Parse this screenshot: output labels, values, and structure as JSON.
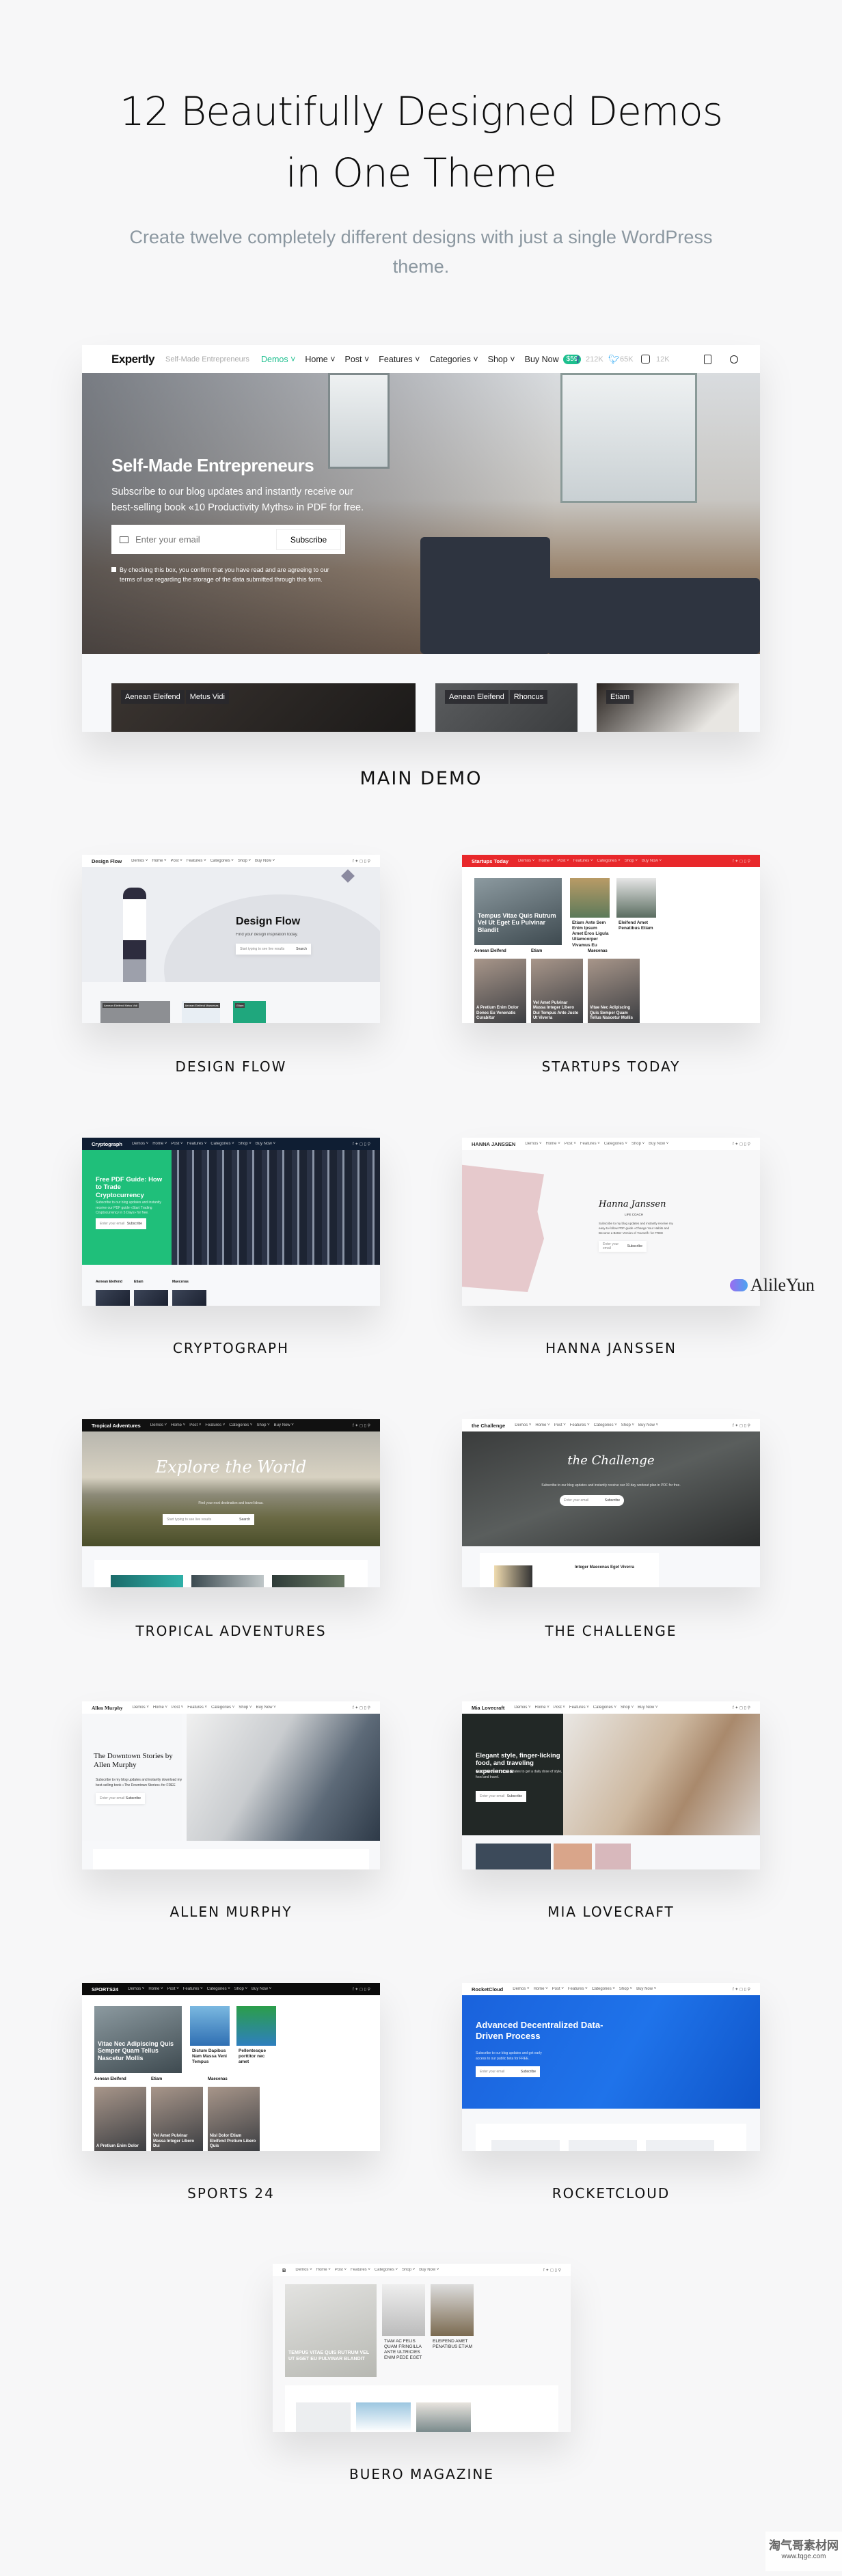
{
  "header": {
    "title_line1": "12 Beautifully Designed Demos",
    "title_line2": "in One Theme",
    "subtitle": "Create twelve completely different designs with just a single WordPress theme."
  },
  "main_demo": {
    "label": "MAIN DEMO",
    "brand": "Expertly",
    "tagline": "Self-Made Entrepreneurs",
    "nav": [
      {
        "label": "Demos",
        "active": true
      },
      {
        "label": "Home"
      },
      {
        "label": "Post"
      },
      {
        "label": "Features"
      },
      {
        "label": "Categories"
      },
      {
        "label": "Shop"
      },
      {
        "label": "Buy Now"
      }
    ],
    "price_badge": "$59",
    "social": [
      {
        "icon": "facebook-icon",
        "count": "212K"
      },
      {
        "icon": "twitter-icon",
        "count": "65K"
      },
      {
        "icon": "instagram-icon",
        "count": "12K"
      }
    ],
    "hero_title": "Self-Made Entrepreneurs",
    "hero_text": "Subscribe to our blog updates and instantly receive our best-selling book «10 Productivity Myths» in PDF for free.",
    "email_placeholder": "Enter your email",
    "subscribe": "Subscribe",
    "consent": "By checking this box, you confirm that you have read and are agreeing to our terms of use regarding the storage of the data submitted through this form.",
    "cards": [
      {
        "tags": [
          "Aenean Eleifend",
          "Metus Vidi"
        ]
      },
      {
        "tags": [
          "Aenean Eleifend",
          "Rhoncus"
        ]
      },
      {
        "tags": [
          "Etiam"
        ]
      }
    ],
    "colors": {
      "accent": "#1dbf8e"
    }
  },
  "demos": [
    {
      "label": "DESIGN FLOW",
      "layout": "illustration",
      "brand": "Design Flow",
      "nav_bg": "#ffffff",
      "nav_fg": "#222222",
      "hero_bg": "#eceef2",
      "fg": "#111111",
      "headline": "Design Flow",
      "sub": "Find your design inspiration today.",
      "input": "Start typing to see live results",
      "button": "Search",
      "cards": [
        {
          "tags": "Aenean Eleifend  Metus Vidi"
        },
        {
          "tags": "Aenean Eleifend  Maecenas"
        },
        {
          "tags": "Etiam"
        }
      ]
    },
    {
      "label": "STARTUPS TODAY",
      "layout": "magazine",
      "brand": "Startups Today",
      "nav_bg": "#e8282b",
      "nav_fg": "#ffffff",
      "headline": "Tempus Vitae Quis Rutrum Vel Ut Eget Eu Pulvinar Blandit",
      "side": [
        "Etiam Ante Sem Enim Ipsum Amet Eros Ligula Ullamcorper Vivamus Eu",
        "Eleifend Amet Penatibus Etiam"
      ],
      "sections": [
        "Aenean Eleifend",
        "Etiam",
        "Maecenas"
      ],
      "bottom": [
        "A Pretium Enim Dolor Donec Eu Venenatis Curabitur",
        "Vel Amet Pulvinar Massa Integer Libero Dui Tempus Ante Justo Ut Viverra",
        "Vitae Nec Adipiscing Quis Semper Quam Tellus Nascetur Mollis"
      ]
    },
    {
      "label": "CRYPTOGRAPH",
      "layout": "split",
      "brand": "Cryptograph",
      "nav_bg": "#0f1e33",
      "nav_fg": "#ffffff",
      "panel_bg": "#1fbf7a",
      "fg": "#ffffff",
      "img_bg": "repeating-linear-gradient(90deg,#2b3346 0 8px,#8892a4 8px 11px,#1d2433 11px 22px),linear-gradient(#333,#555)",
      "headline": "Free PDF Guide: How to Trade Cryptocurrency",
      "sub": "Subscribe to our blog updates and instantly receive our PDF guide «Start Trading Cryptocurrency in 5 Days» for free.",
      "input": "Enter your email",
      "button": "Subscribe",
      "sections": [
        "Aenean Eleifend",
        "Etiam",
        "Maecenas"
      ]
    },
    {
      "label": "HANNA JANSSEN",
      "layout": "portrait",
      "brand": "HANNA JANSSEN",
      "nav_bg": "#ffffff",
      "nav_fg": "#333333",
      "headline": "Hanna Janssen",
      "kicker": "LIFE COACH",
      "sub": "Subscribe to my blog updates and instantly receive my easy-to-follow PDF-guide «Change Your Habits and Become a Better Version of Yourself» for FREE",
      "input": "Enter your email",
      "button": "Subscribe"
    },
    {
      "label": "TROPICAL ADVENTURES",
      "layout": "hero",
      "brand": "Tropical Adventures",
      "nav_bg": "#111111",
      "nav_fg": "#ffffff",
      "hero_bg": "linear-gradient(180deg,#b8b6ae 0%,#d8d2c2 40%,#8c8a78 55%,#6b6a45 75%,#4a4e2a 100%)",
      "fg": "#ffffff",
      "script": true,
      "headline": "Explore the World",
      "sub": "Find your next destination and travel ideas.",
      "input": "Start typing to see live results",
      "button": "Search",
      "align": "center"
    },
    {
      "label": "THE CHALLENGE",
      "layout": "hero",
      "brand": "the Challenge",
      "nav_bg": "#ffffff",
      "nav_fg": "#222222",
      "hero_bg": "linear-gradient(160deg,#3a3c3c 0%,#5a5e5d 50%,#2b2d2d 100%)",
      "fg": "#ffffff",
      "script": true,
      "headline": "the Challenge",
      "sub": "Subscribe to our blog updates and instantly receive our 30 day workout plan in PDF for free.",
      "input": "Enter your email",
      "button": "Subscribe",
      "align": "center",
      "extra": "Integer Maecenas Eget Viverra"
    },
    {
      "label": "ALLEN MURPHY",
      "layout": "split",
      "brand": "Allen Murphy",
      "nav_bg": "#ffffff",
      "nav_fg": "#222222",
      "panel_bg": "#f6f7f9",
      "fg": "#111111",
      "serif": true,
      "img_bg": "linear-gradient(120deg,#f0f0f0 0%,#c9cccf 40%,#5d6a78 70%,#2e3a48 100%)",
      "headline": "The Downtown Stories by Allen Murphy",
      "sub": "Subscribe to my blog updates and instantly download my best-selling book «The Downtown Stories» for FREE",
      "input": "Enter your email",
      "button": "Subscribe"
    },
    {
      "label": "MIA LOVECRAFT",
      "layout": "split",
      "brand": "Mia Lovecraft",
      "nav_bg": "#ffffff",
      "nav_fg": "#222222",
      "panel_bg": "#222826",
      "fg": "#ffffff",
      "img_bg": "linear-gradient(120deg,#e9e7e4 0%,#cdb8a0 45%,#a9896c 65%,#d9d2cc 100%)",
      "headline": "Elegant style, finger-licking food, and traveling experiences",
      "sub": "Subscribe to my blog updates to get a daily dose of style, food and travel.",
      "input": "Enter your email",
      "button": "Subscribe"
    },
    {
      "label": "SPORTS 24",
      "layout": "magazine",
      "brand": "SPORTS24",
      "nav_bg": "#0b0b0b",
      "nav_fg": "#ffffff",
      "headline": "Vitae Nec Adipiscing Quis Semper Quam Tellus Nascetur Mollis",
      "side": [
        "Dictum Dapibus Nam Massa Veni Tempus",
        "Pellentesque porttitor nec amet"
      ],
      "sections": [
        "Aenean Eleifend",
        "Etiam",
        "Maecenas"
      ],
      "bottom": [
        "A Pretium Enim Dolor",
        "Vel Amet Pulvinar Massa Integer Libero Dui",
        "Nisl Dolor Etiam Eleifend Pretium Libero Quis"
      ]
    },
    {
      "label": "ROCKETCLOUD",
      "layout": "hero",
      "brand": "RocketCloud",
      "nav_bg": "#ffffff",
      "nav_fg": "#222222",
      "hero_bg": "linear-gradient(120deg,#1a62dc 0%,#1f73ea 55%,#0f55c9 100%)",
      "fg": "#ffffff",
      "headline": "Advanced Decentralized Data-Driven Process",
      "sub": "Subscribe to our blog updates and get early access to our public beta for FREE.",
      "input": "Enter your email",
      "button": "Subscribe",
      "align": "left"
    },
    {
      "label": "BUERO MAGAZINE",
      "layout": "magazine",
      "brand": "B",
      "nav_bg": "#ffffff",
      "nav_fg": "#333333",
      "upper": true,
      "headline": "TEMPUS VITAE QUIS RUTRUM VEL UT EGET EU PULVINAR BLANDIT",
      "side": [
        "TIAM AC FELIS QUAM FRINGILLA ANTE ULTRICIES ENIM PEDE EGET",
        "ELEIFEND AMET PENATIBUS ETIAM"
      ],
      "sections": [],
      "bottom": [
        "",
        "",
        ""
      ]
    }
  ],
  "demo_nav": [
    "Demos",
    "Home",
    "Post",
    "Features",
    "Categories",
    "Shop",
    "Buy Now"
  ],
  "watermarks": {
    "alileyun": "AlileYun",
    "tqge": "淘气哥素材网",
    "tqge_url": "www.tqge.com"
  }
}
